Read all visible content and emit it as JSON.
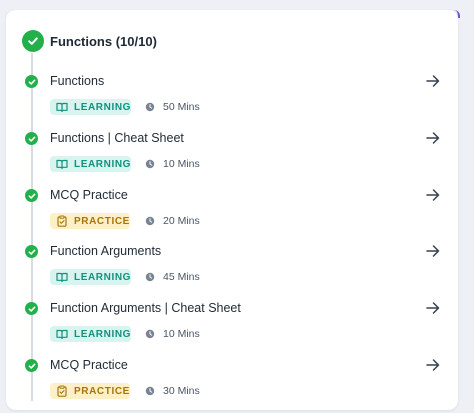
{
  "section": {
    "title": "Functions (10/10)"
  },
  "items": [
    {
      "title": "Functions",
      "tag": "LEARNING",
      "duration": "50 Mins"
    },
    {
      "title": "Functions | Cheat Sheet",
      "tag": "LEARNING",
      "duration": "10 Mins"
    },
    {
      "title": "MCQ Practice",
      "tag": "PRACTICE",
      "duration": "20 Mins"
    },
    {
      "title": "Function Arguments",
      "tag": "LEARNING",
      "duration": "45 Mins"
    },
    {
      "title": "Function Arguments | Cheat Sheet",
      "tag": "LEARNING",
      "duration": "10 Mins"
    },
    {
      "title": "MCQ Practice",
      "tag": "PRACTICE",
      "duration": "30 Mins"
    }
  ],
  "colors": {
    "complete": "#22b04b",
    "learning_bg": "#d8f4ef",
    "learning_text": "#12917e",
    "practice_bg": "#fdf0c7",
    "practice_text": "#a8740b"
  },
  "icons": {
    "section_status": "check-circle-icon",
    "item_status": "check-circle-icon",
    "learning": "book-icon",
    "practice": "clipboard-icon",
    "duration": "clock-icon",
    "open": "arrow-right-icon"
  }
}
